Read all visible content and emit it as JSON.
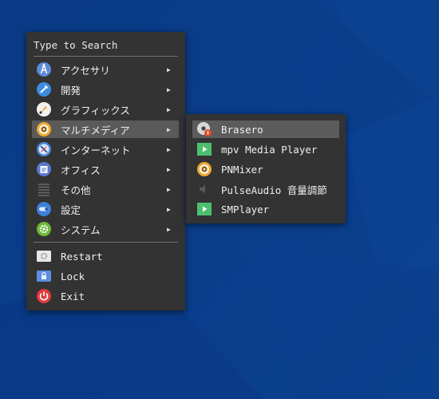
{
  "search": {
    "placeholder": "Type to Search"
  },
  "categories": [
    {
      "label": "アクセサリ",
      "icon": "accessories-icon"
    },
    {
      "label": "開発",
      "icon": "development-icon"
    },
    {
      "label": "グラフィックス",
      "icon": "graphics-icon"
    },
    {
      "label": "マルチメディア",
      "icon": "multimedia-icon"
    },
    {
      "label": "インターネット",
      "icon": "internet-icon"
    },
    {
      "label": "オフィス",
      "icon": "office-icon"
    },
    {
      "label": "その他",
      "icon": "other-icon"
    },
    {
      "label": "設定",
      "icon": "settings-icon"
    },
    {
      "label": "システム",
      "icon": "system-icon"
    }
  ],
  "actions": [
    {
      "label": "Restart",
      "icon": "restart-icon"
    },
    {
      "label": "Lock",
      "icon": "lock-icon"
    },
    {
      "label": "Exit",
      "icon": "power-icon"
    }
  ],
  "submenu": {
    "items": [
      {
        "label": "Brasero",
        "icon": "brasero-icon"
      },
      {
        "label": "mpv Media Player",
        "icon": "mpv-icon"
      },
      {
        "label": "PNMixer",
        "icon": "pnmixer-icon"
      },
      {
        "label": "PulseAudio 音量調節",
        "icon": "speaker-icon"
      },
      {
        "label": "SMPlayer",
        "icon": "smplayer-icon"
      }
    ]
  },
  "colors": {
    "desktop": "#0b3f8e",
    "menu_bg": "#333333",
    "highlight": "#5a5a5a"
  }
}
